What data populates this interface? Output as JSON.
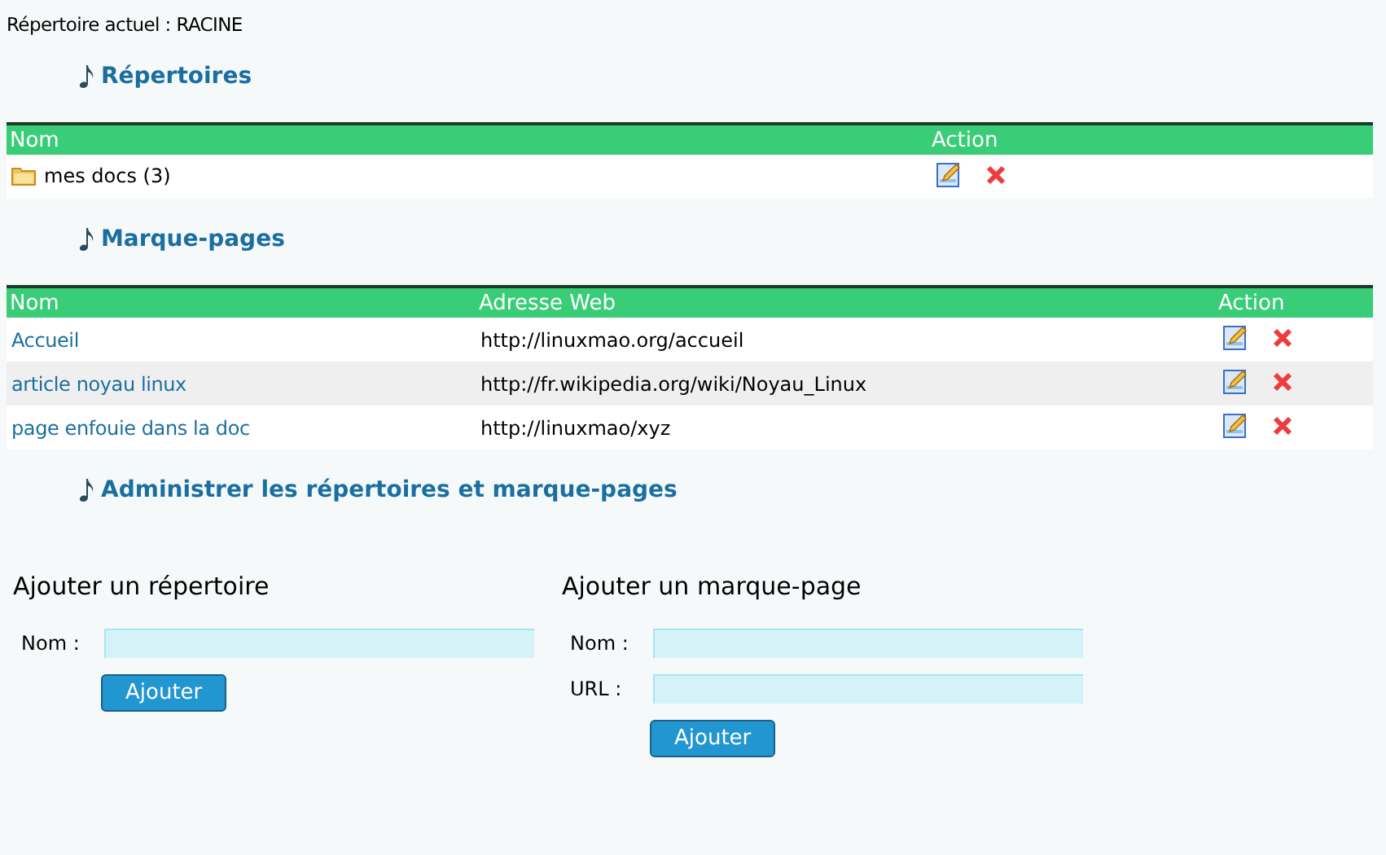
{
  "current_dir": {
    "label": "Répertoire actuel : RACINE"
  },
  "directories": {
    "title": "Répertoires",
    "columns": [
      "Nom",
      "Action"
    ],
    "rows": [
      {
        "name": "mes docs (3)"
      }
    ]
  },
  "bookmarks": {
    "title": "Marque-pages",
    "columns": [
      "Nom",
      "Adresse Web",
      "Action"
    ],
    "rows": [
      {
        "name": "Accueil",
        "url": "http://linuxmao.org/accueil"
      },
      {
        "name": "article noyau linux",
        "url": "http://fr.wikipedia.org/wiki/Noyau_Linux"
      },
      {
        "name": "page enfouie dans la doc",
        "url": "http://linuxmao/xyz"
      }
    ]
  },
  "admin": {
    "title": "Administrer les répertoires et marque-pages",
    "add_directory": {
      "title": "Ajouter un répertoire",
      "fields": [
        {
          "label": "Nom :"
        }
      ],
      "button": "Ajouter"
    },
    "add_bookmark": {
      "title": "Ajouter un marque-page",
      "fields": [
        {
          "label": "Nom :"
        },
        {
          "label": "URL :"
        }
      ],
      "button": "Ajouter"
    }
  }
}
